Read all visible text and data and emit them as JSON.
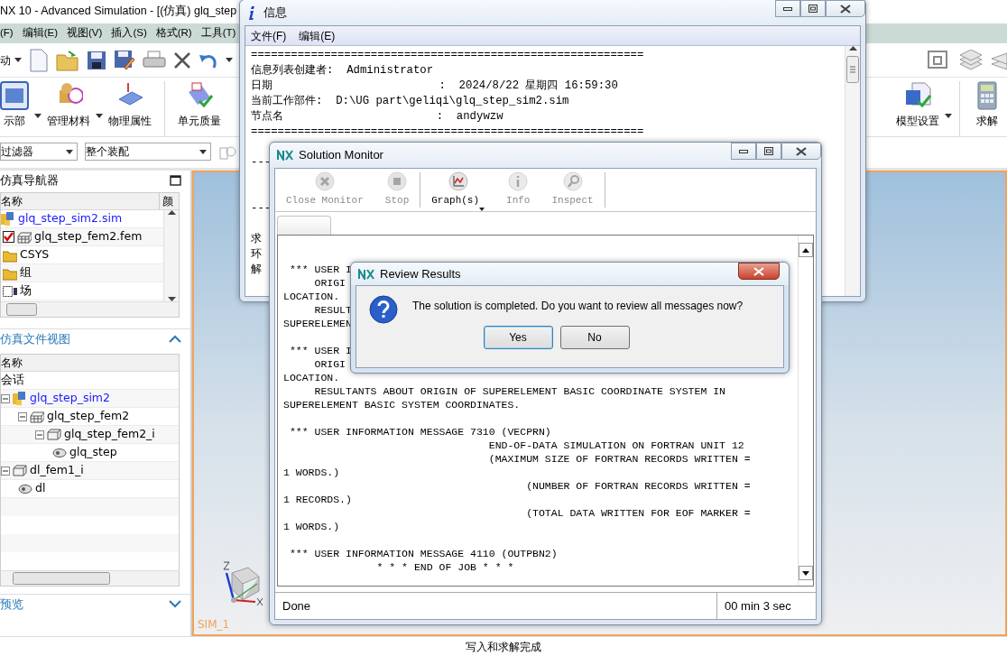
{
  "main_window": {
    "title": "NX 10 - Advanced Simulation - [(仿真) glq_step",
    "menu": [
      "(F)",
      "编辑(E)",
      "视图(V)",
      "插入(S)",
      "格式(R)",
      "工具(T)"
    ],
    "toolbar": {
      "dropdown": "动"
    },
    "ribbon_left": [
      {
        "label": "示部",
        "kind": "part",
        "dropdown": true
      },
      {
        "label": "管理材料",
        "kind": "material",
        "dropdown": true
      },
      {
        "label": "物理属性",
        "kind": "physical",
        "dropdown": false
      },
      {
        "label": "单元质量",
        "kind": "quality",
        "dropdown": false
      }
    ],
    "ribbon_right": [
      {
        "label": "模型设置",
        "kind": "setup",
        "dropdown": true
      },
      {
        "label": "求解",
        "kind": "solve",
        "dropdown": false
      }
    ],
    "filters": [
      {
        "value": "过滤器"
      },
      {
        "value": "整个装配"
      }
    ],
    "navigator": {
      "title": "仿真导航器",
      "columns": [
        "名称",
        "颜"
      ],
      "tree": [
        {
          "label": "glq_step_sim2.sim",
          "kind": "sim",
          "link": true,
          "children": [
            {
              "label": "glq_step_fem2.fem",
              "kind": "mesh",
              "checked": true
            },
            {
              "label": "CSYS",
              "kind": "folder"
            },
            {
              "label": "组",
              "kind": "folder"
            },
            {
              "label": "场",
              "kind": "field"
            }
          ]
        }
      ]
    },
    "file_view": {
      "title": "仿真文件视图",
      "columns": [
        "名称"
      ],
      "tree": [
        {
          "label": "会话",
          "children": [
            {
              "label": "glq_step_sim2",
              "kind": "sim",
              "link": true,
              "expanded": true,
              "children": [
                {
                  "label": "glq_step_fem2",
                  "kind": "mesh",
                  "expanded": true,
                  "children": [
                    {
                      "label": "glq_step_fem2_i",
                      "kind": "idealized",
                      "expanded": true,
                      "children": [
                        {
                          "label": "glq_step",
                          "kind": "part"
                        }
                      ]
                    }
                  ]
                }
              ]
            },
            {
              "label": "dl_fem1_i",
              "kind": "idealized",
              "expanded": true,
              "children": [
                {
                  "label": "dl",
                  "kind": "part"
                }
              ]
            }
          ]
        }
      ]
    },
    "preview": {
      "title": "预览"
    },
    "viewport": {
      "label": "SIM_1"
    },
    "status_bar": "写入和求解完成"
  },
  "info_window": {
    "title": "信息",
    "menu": [
      "文件(F)",
      "编辑(E)"
    ],
    "lines": [
      {
        "kind": "text",
        "text": "==========================================================="
      },
      {
        "kind": "text",
        "text": "信息列表创建者:  Administrator"
      },
      {
        "kind": "text",
        "text": "日期                         :  2024/8/22 星期四 16:59:30"
      },
      {
        "kind": "text",
        "text": "当前工作部件:  D:\\UG part\\geliqi\\glq_step_sim2.sim"
      },
      {
        "kind": "text",
        "text": "节点名                       :  andywzw"
      },
      {
        "kind": "text",
        "text": "==========================================================="
      },
      {
        "kind": "blank"
      },
      {
        "kind": "text",
        "text": "---"
      },
      {
        "kind": "blank"
      },
      {
        "kind": "blank"
      },
      {
        "kind": "text",
        "text": "---"
      },
      {
        "kind": "blank"
      },
      {
        "kind": "text",
        "text": "求"
      },
      {
        "kind": "text",
        "text": "环"
      },
      {
        "kind": "text",
        "text": "解"
      }
    ]
  },
  "solution_monitor": {
    "title": "Solution Monitor",
    "buttons": [
      {
        "label": "Close Monitor",
        "kind": "close",
        "disabled": true,
        "dropdown": false
      },
      {
        "label": "Stop",
        "kind": "stop",
        "disabled": true,
        "dropdown": false
      },
      {
        "label": "Graph(s)",
        "kind": "graph",
        "disabled": false,
        "dropdown": true
      },
      {
        "label": "Info",
        "kind": "info",
        "disabled": true,
        "dropdown": false
      },
      {
        "label": "Inspect",
        "kind": "inspect",
        "disabled": true,
        "dropdown": false
      }
    ],
    "log": [
      {
        "kind": "blank"
      },
      {
        "kind": "blank"
      },
      {
        "kind": "text",
        "text": " *** USER I"
      },
      {
        "kind": "text",
        "text": "     ORIGI"
      },
      {
        "kind": "text",
        "text": "LOCATION."
      },
      {
        "kind": "text",
        "text": "     RESULT"
      },
      {
        "kind": "text",
        "text": "SUPERELEMEN"
      },
      {
        "kind": "blank"
      },
      {
        "kind": "text",
        "text": " *** USER I"
      },
      {
        "kind": "text",
        "text": "     ORIGI"
      },
      {
        "kind": "text",
        "text": "LOCATION."
      },
      {
        "kind": "text",
        "text": "     RESULTANTS ABOUT ORIGIN OF SUPERELEMENT BASIC COORDINATE SYSTEM IN"
      },
      {
        "kind": "text",
        "text": "SUPERELEMENT BASIC SYSTEM COORDINATES."
      },
      {
        "kind": "blank"
      },
      {
        "kind": "text",
        "text": " *** USER INFORMATION MESSAGE 7310 (VECPRN)"
      },
      {
        "kind": "text",
        "text": "                                 END-OF-DATA SIMULATION ON FORTRAN UNIT 12"
      },
      {
        "kind": "text",
        "text": "                                 (MAXIMUM SIZE OF FORTRAN RECORDS WRITTEN ="
      },
      {
        "kind": "text",
        "text": "1 WORDS.)"
      },
      {
        "kind": "text",
        "text": "                                       (NUMBER OF FORTRAN RECORDS WRITTEN ="
      },
      {
        "kind": "text",
        "text": "1 RECORDS.)"
      },
      {
        "kind": "text",
        "text": "                                       (TOTAL DATA WRITTEN FOR EOF MARKER ="
      },
      {
        "kind": "text",
        "text": "1 WORDS.)"
      },
      {
        "kind": "blank"
      },
      {
        "kind": "text",
        "text": " *** USER INFORMATION MESSAGE 4110 (OUTPBN2)"
      },
      {
        "kind": "text",
        "text": "               * * * END OF JOB * * *"
      }
    ],
    "status": "Done",
    "elapsed": "00 min 3 sec"
  },
  "review_dialog": {
    "title": "Review Results",
    "message": "The solution is completed. Do you want to review all messages now?",
    "buttons": [
      {
        "label": "Yes",
        "selected": true
      },
      {
        "label": "No",
        "selected": false
      }
    ]
  }
}
